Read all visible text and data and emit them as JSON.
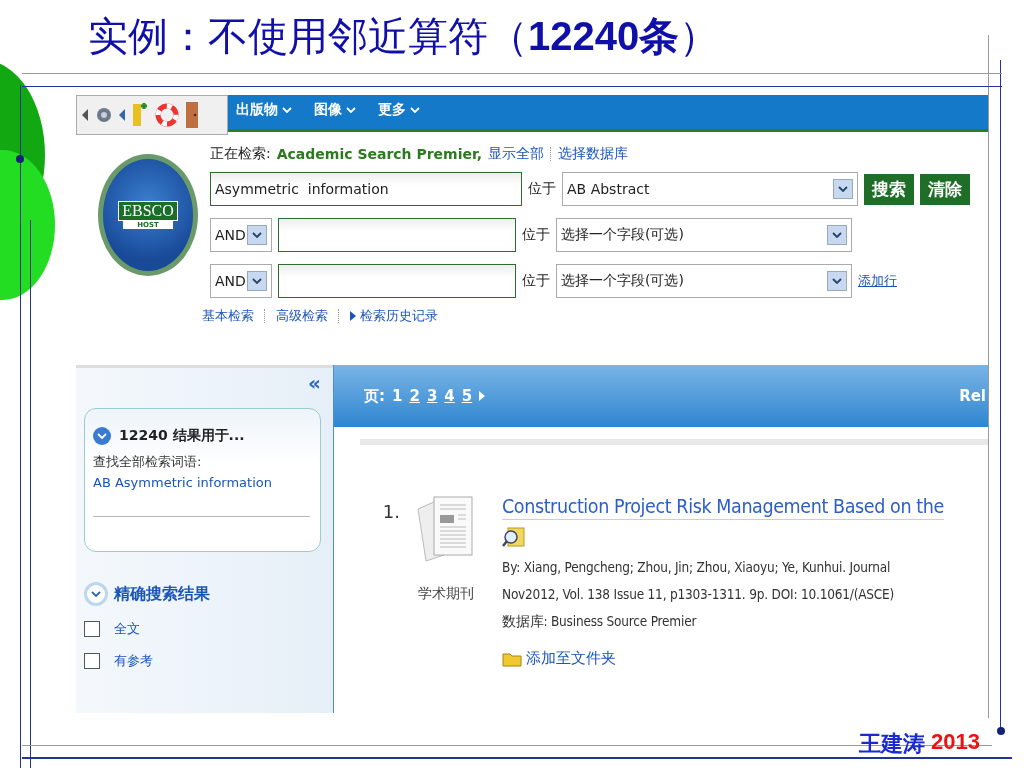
{
  "slide": {
    "title": "实例：不使用邻近算符（**12240条**）",
    "author": "王建涛",
    "year": "2013"
  },
  "topbar": {
    "nav_tabs": [
      "出版物",
      "图像",
      "更多"
    ]
  },
  "search": {
    "logo": {
      "top": "EBSCO",
      "bottom": "HOST"
    },
    "searching_label": "正在检索:",
    "database": "Academic Search Premier,",
    "links": [
      "显示全部",
      "选择数据库"
    ],
    "rows": [
      {
        "value": "Asymmetric  information",
        "in_label": "位于",
        "field": "AB Abstract"
      },
      {
        "operator": "AND",
        "in_label": "位于",
        "field": "选择一个字段(可选)"
      },
      {
        "operator": "AND",
        "in_label": "位于",
        "field": "选择一个字段(可选)"
      }
    ],
    "buttons": [
      "搜索",
      "清除"
    ],
    "add_row": "添加行",
    "mode_links": [
      "基本检索",
      "高级检索",
      "检索历史记录"
    ]
  },
  "sidebar": {
    "collapse": "«",
    "count_heading": "12240 结果用于...",
    "terms_label": "查找全部检索词语:",
    "terms": "AB Asymmetric information",
    "refine_heading": "精确搜索结果",
    "options": [
      {
        "label": "全文",
        "checked": false
      },
      {
        "label": "有参考",
        "checked": false
      }
    ]
  },
  "results": {
    "pager": {
      "label": "页:",
      "pages": [
        {
          "label": "1",
          "selected": true
        },
        {
          "label": "2",
          "selected": false
        },
        {
          "label": "3",
          "selected": false
        },
        {
          "label": "4",
          "selected": false
        },
        {
          "label": "5",
          "selected": false
        }
      ]
    },
    "sort_label": "Rel",
    "items": [
      {
        "number": "1.",
        "type": "学术期刊",
        "title": "Construction Project Risk Management Based on the",
        "byline": "By: Xiang, Pengcheng; Zhou, Jin; Zhou, Xiaoyu; Ye, Kunhui. Journal",
        "source": "Nov2012, Vol. 138 Issue 11, p1303-1311. 9p. DOI: 10.1061/(ASCE)",
        "db_label": "数据库:",
        "db": "Business Source Premier",
        "folder": "添加至文件夹"
      }
    ]
  }
}
